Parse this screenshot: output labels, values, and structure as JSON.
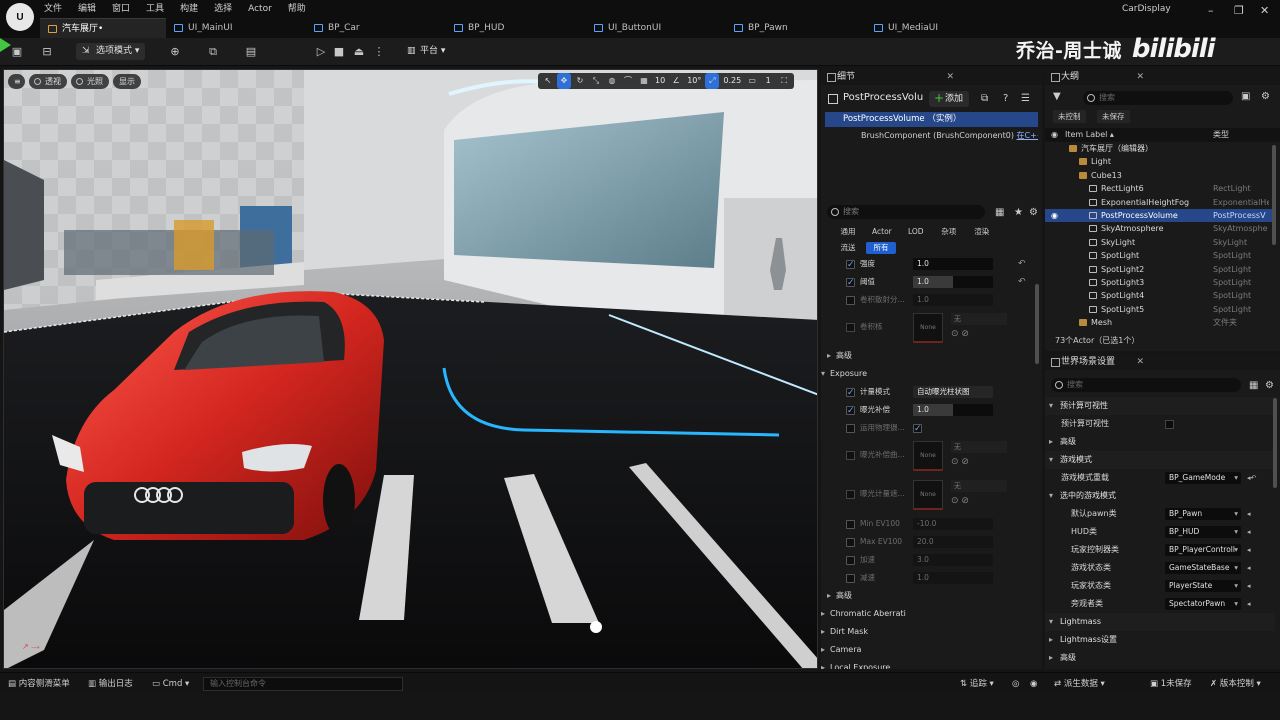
{
  "menu": [
    "文件",
    "编辑",
    "窗口",
    "工具",
    "构建",
    "选择",
    "Actor",
    "帮助"
  ],
  "tabs": [
    {
      "label": "汽车展厅•",
      "active": true
    },
    {
      "label": "UI_MainUI",
      "active": false
    },
    {
      "label": "BP_Car",
      "active": false
    },
    {
      "label": "BP_HUD",
      "active": false
    },
    {
      "label": "UI_ButtonUI",
      "active": false
    },
    {
      "label": "BP_Pawn",
      "active": false
    },
    {
      "label": "UI_MediaUI",
      "active": false
    }
  ],
  "project_name": "CarDisplay",
  "watermark": {
    "text": "乔治-周士诚",
    "logo": "bilibili"
  },
  "toolbar": {
    "mode_label": "选项模式",
    "platform_label": "平台"
  },
  "viewport": {
    "pills": [
      "透视",
      "光照",
      "显示"
    ],
    "grid_snap": "10",
    "rot_snap": "10°",
    "scale_snap": "0.25",
    "camera_speed": "1"
  },
  "details": {
    "title": "细节",
    "actor_name": "PostProcessVolu",
    "add_label": "添加",
    "root_component": "PostProcessVolume （实例）",
    "child_component": "BrushComponent (BrushComponent0)",
    "child_link": "在C++中",
    "search_placeholder": "搜索",
    "filters_row1": [
      "通用",
      "Actor",
      "LOD",
      "杂项",
      "渲染"
    ],
    "filters_row2": [
      "流送",
      "所有"
    ],
    "props": {
      "intensity": {
        "label": "强度",
        "value": "1.0"
      },
      "threshold": {
        "label": "阈值",
        "value": "1.0"
      },
      "scale": {
        "label": "卷积散射分...",
        "value": "1.0"
      },
      "kernel": {
        "label": "卷积核",
        "thumb": "None",
        "drop": "无"
      },
      "advanced1": "高级",
      "exposure": "Exposure",
      "metering": {
        "label": "计量模式",
        "value": "自动曝光柱状图"
      },
      "exp_comp": {
        "label": "曝光补偿",
        "value": "1.0"
      },
      "phys_cam": {
        "label": "运用物理摄..."
      },
      "curve": {
        "label": "曝光补偿曲...",
        "thumb": "None",
        "drop": "无"
      },
      "mask": {
        "label": "曝光计量遮...",
        "thumb": "None",
        "drop": "无"
      },
      "min_ev": {
        "label": "Min EV100",
        "value": "-10.0"
      },
      "max_ev": {
        "label": "Max EV100",
        "value": "20.0"
      },
      "speed_up": {
        "label": "加速",
        "value": "3.0"
      },
      "speed_down": {
        "label": "减速",
        "value": "1.0"
      },
      "advanced2": "高级",
      "chromatic": "Chromatic Aberrati",
      "dirt": "Dirt Mask",
      "camera": "Camera",
      "local_exp": "Local Exposure"
    }
  },
  "outliner": {
    "title": "大纲",
    "search_placeholder": "搜索",
    "btn_unsaved": "未控制",
    "btn_save": "未保存",
    "col_label": "Item Label ▴",
    "col_type": "类型",
    "rows": [
      {
        "name": "汽车展厅（编辑器）",
        "type": "",
        "indent": 1,
        "folder": true
      },
      {
        "name": "Light",
        "type": "",
        "indent": 2,
        "folder": true
      },
      {
        "name": "Cube13",
        "type": "",
        "indent": 2,
        "folder": true
      },
      {
        "name": "RectLight6",
        "type": "RectLight",
        "indent": 3,
        "folder": false
      },
      {
        "name": "ExponentialHeightFog",
        "type": "ExponentialHe",
        "indent": 3,
        "folder": false
      },
      {
        "name": "PostProcessVolume",
        "type": "PostProcessV",
        "indent": 3,
        "folder": false,
        "selected": true
      },
      {
        "name": "SkyAtmosphere",
        "type": "SkyAtmosphe",
        "indent": 3,
        "folder": false
      },
      {
        "name": "SkyLight",
        "type": "SkyLight",
        "indent": 3,
        "folder": false
      },
      {
        "name": "SpotLight",
        "type": "SpotLight",
        "indent": 3,
        "folder": false
      },
      {
        "name": "SpotLight2",
        "type": "SpotLight",
        "indent": 3,
        "folder": false
      },
      {
        "name": "SpotLight3",
        "type": "SpotLight",
        "indent": 3,
        "folder": false
      },
      {
        "name": "SpotLight4",
        "type": "SpotLight",
        "indent": 3,
        "folder": false
      },
      {
        "name": "SpotLight5",
        "type": "SpotLight",
        "indent": 3,
        "folder": false
      },
      {
        "name": "Mesh",
        "type": "文件夹",
        "indent": 2,
        "folder": true
      }
    ],
    "footer": "73个Actor（已选1个）"
  },
  "world": {
    "title": "世界场景设置",
    "search_placeholder": "搜索",
    "sec_precompute": "预计算可视性",
    "precompute_label": "预计算可视性",
    "advanced": "高级",
    "sec_game_mode": "游戏模式",
    "game_mode_override_label": "游戏模式重载",
    "game_mode_override": "BP_GameMode",
    "sec_selected": "选中的游戏模式",
    "rows": [
      {
        "label": "默认pawn类",
        "value": "BP_Pawn"
      },
      {
        "label": "HUD类",
        "value": "BP_HUD"
      },
      {
        "label": "玩家控制器类",
        "value": "BP_PlayerControll"
      },
      {
        "label": "游戏状态类",
        "value": "GameStateBase"
      },
      {
        "label": "玩家状态类",
        "value": "PlayerState"
      },
      {
        "label": "旁观者类",
        "value": "SpectatorPawn"
      }
    ],
    "sec_lightmass": "Lightmass",
    "lightmass_settings": "Lightmass设置",
    "advanced2": "高级"
  },
  "statusbar": {
    "content_drawer": "内容侧滑菜单",
    "output_log": "输出日志",
    "cmd": "Cmd",
    "console_placeholder": "输入控制台命令",
    "trace": "追踪",
    "derived_data": "派生数据",
    "unsaved": "1未保存",
    "source_control": "版本控制"
  }
}
